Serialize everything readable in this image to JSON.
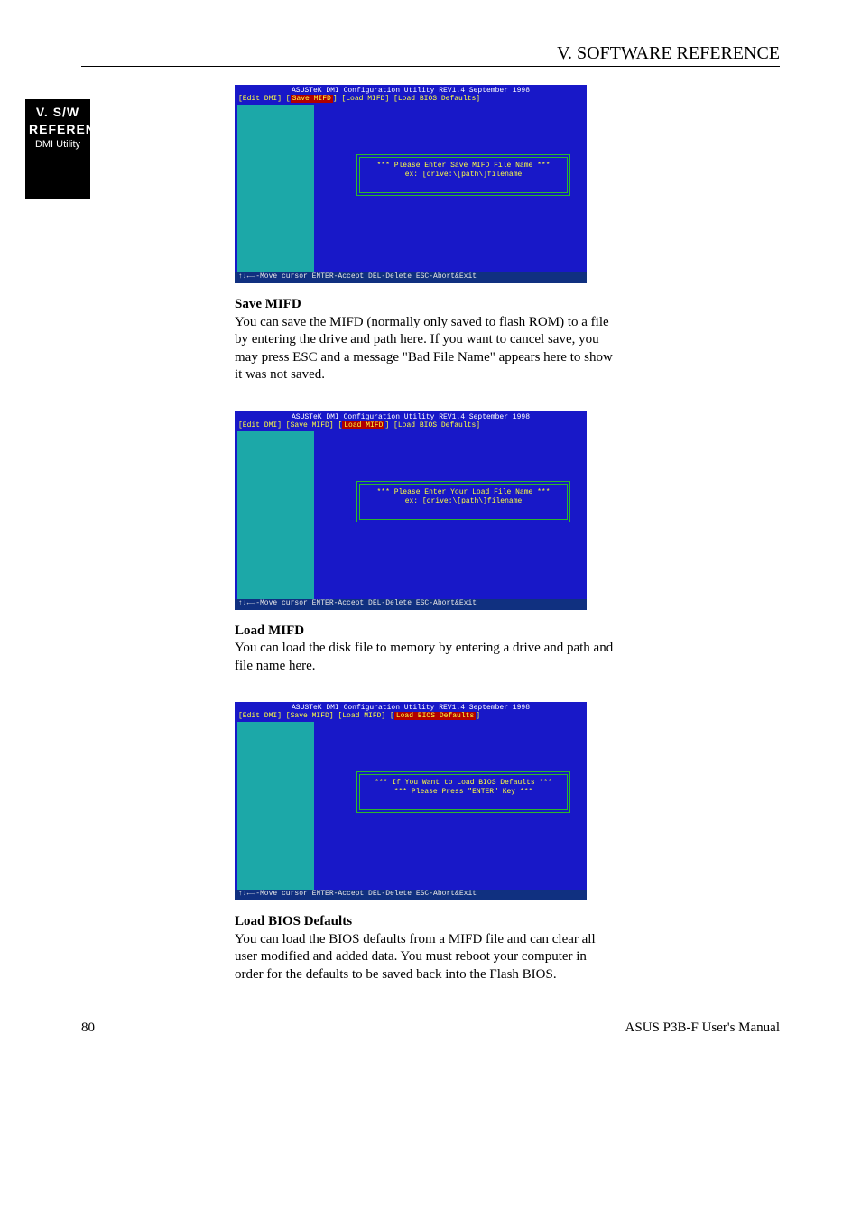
{
  "header": {
    "section_title": "V. SOFTWARE REFERENCE"
  },
  "side_tab": {
    "line1": "V. S/W",
    "line2": "REFERENCE",
    "line3": "DMI Utility"
  },
  "screens": {
    "bios_title": "ASUSTeK DMI Configuration Utility  REV1.4  September 1998",
    "footer": "↑↓←→-Move cursor  ENTER-Accept  DEL-Delete  ESC-Abort&Exit",
    "s1": {
      "menu_pre": "[Edit DMI] [",
      "menu_sel": "Save MIFD",
      "menu_post": "] [Load MIFD] [Load BIOS Defaults]",
      "prompt_l1": "*** Please Enter Save MIFD File Name ***",
      "prompt_l2": "ex: [drive:\\[path\\]filename"
    },
    "s2": {
      "menu_pre": "[Edit DMI] [Save MIFD] [",
      "menu_sel": "Load MIFD",
      "menu_post": "] [Load BIOS Defaults]",
      "prompt_l1": "*** Please Enter Your Load File Name ***",
      "prompt_l2": "ex: [drive:\\[path\\]filename"
    },
    "s3": {
      "menu_pre": "[Edit DMI] [Save MIFD] [Load MIFD] [",
      "menu_sel": "Load BIOS Defaults",
      "menu_post": "]",
      "prompt_l1": "*** If You Want to Load BIOS Defaults ***",
      "prompt_l2": "*** Please Press \"ENTER\" Key ***"
    }
  },
  "captions": {
    "c1_bold": "Save MIFD",
    "c1_text": "You can save the MIFD (normally only saved to flash ROM) to a file by entering the drive and path here. If you want to cancel save, you may press ESC and a message \"Bad File Name\" appears here to show it was not saved.",
    "c2_bold": "Load MIFD",
    "c2_text": "You can load the disk file to memory by entering a drive and path and file name here.",
    "c3_bold": "Load BIOS Defaults",
    "c3_text": "You can load the BIOS defaults from a MIFD file and can clear all user modified and added data. You must reboot your computer in order for the defaults to be saved back into the Flash BIOS."
  },
  "footer": {
    "page": "80",
    "product": "ASUS P3B-F User's Manual"
  }
}
